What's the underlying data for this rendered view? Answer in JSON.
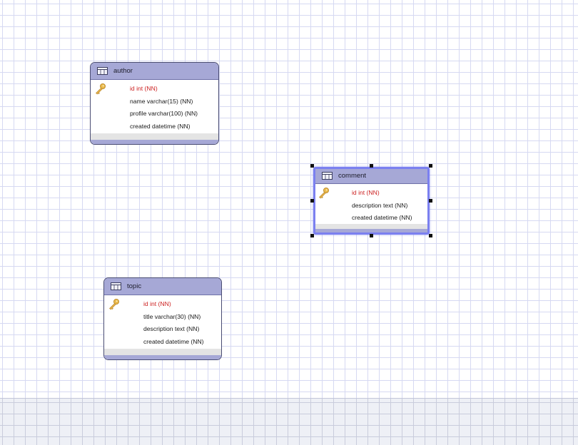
{
  "canvas": {
    "grid_color": "#d6d9f2",
    "background": "#ffffff"
  },
  "icons": {
    "table": "table-icon",
    "primary_key": "key-icon"
  },
  "colors": {
    "header": "#a6a8d6",
    "primary_key_text": "#cc1f1f",
    "selection": "#7b80f0"
  },
  "entities": {
    "author": {
      "name": "author",
      "columns": [
        "id int (NN)",
        "name varchar(15) (NN)",
        "profile varchar(100) (NN)",
        "created datetime (NN)"
      ]
    },
    "comment": {
      "name": "comment",
      "selected": true,
      "columns": [
        "id int (NN)",
        "description text (NN)",
        "created datetime (NN)"
      ]
    },
    "topic": {
      "name": "topic",
      "columns": [
        "id int (NN)",
        "title varchar(30) (NN)",
        "description text (NN)",
        "created datetime (NN)"
      ]
    }
  }
}
